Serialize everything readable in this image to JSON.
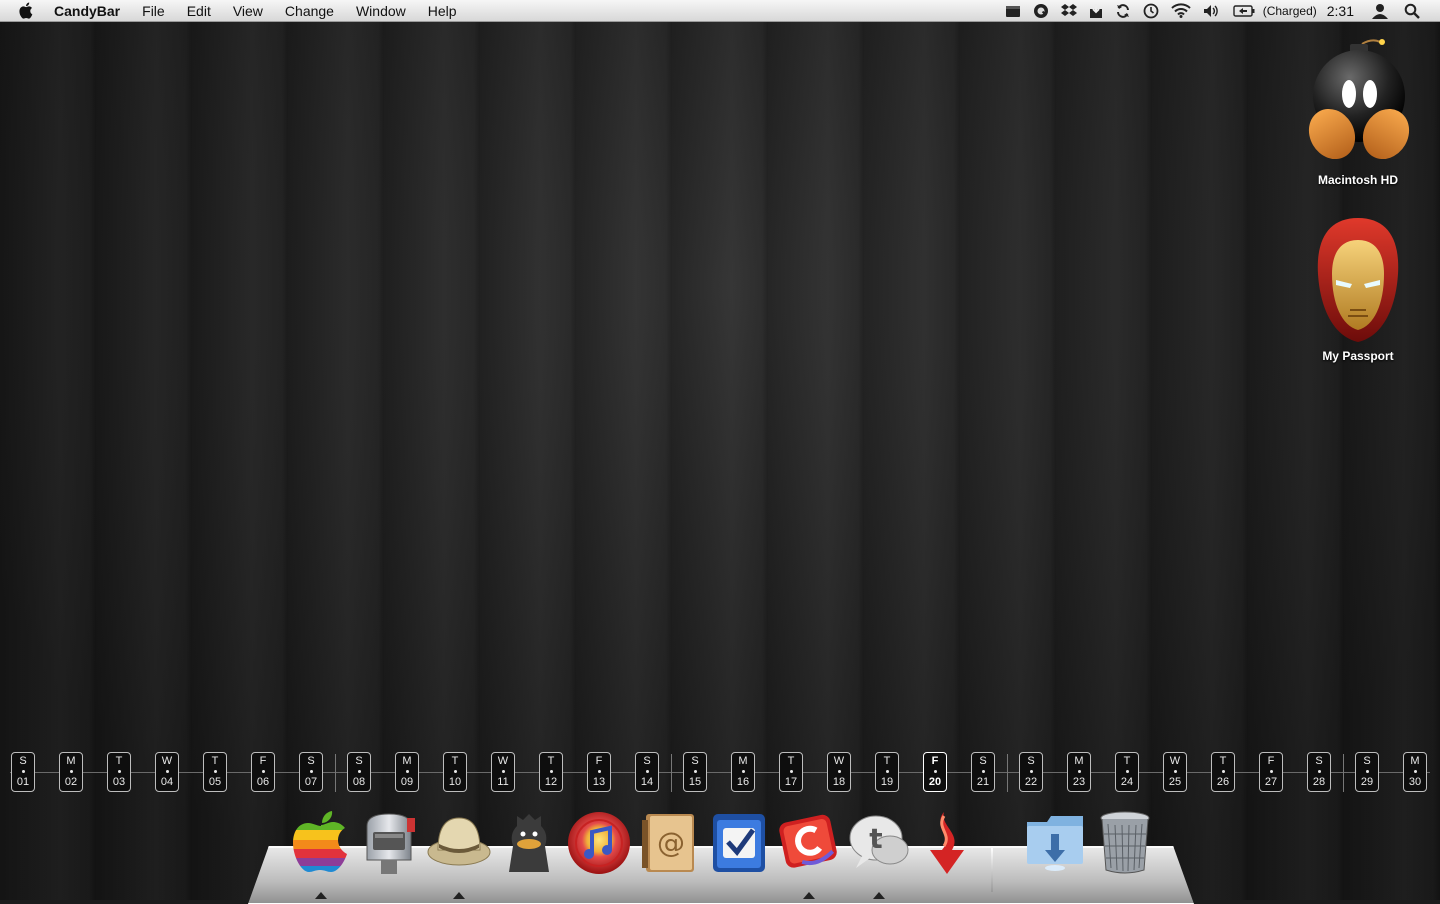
{
  "menubar": {
    "app_name": "CandyBar",
    "menus": [
      "File",
      "Edit",
      "View",
      "Change",
      "Window",
      "Help"
    ],
    "status_icons": [
      "menu-extra-icon",
      "quicksilver-icon",
      "dropbox-icon",
      "download-icon",
      "sync-icon",
      "time-machine-icon",
      "wifi-icon",
      "volume-icon",
      "battery-icon"
    ],
    "battery_status": "(Charged)",
    "clock": "2:31",
    "user_icon": "user-icon",
    "search_icon": "spotlight-icon"
  },
  "desktop_icons": [
    {
      "label": "Macintosh HD",
      "icon": "bomb-disk-icon"
    },
    {
      "label": "My Passport",
      "icon": "iron-man-disk-icon"
    }
  ],
  "calendar": {
    "days": [
      {
        "l": "S",
        "n": "01"
      },
      {
        "l": "M",
        "n": "02"
      },
      {
        "l": "T",
        "n": "03"
      },
      {
        "l": "W",
        "n": "04"
      },
      {
        "l": "T",
        "n": "05"
      },
      {
        "l": "F",
        "n": "06"
      },
      {
        "l": "S",
        "n": "07"
      },
      {
        "l": "S",
        "n": "08"
      },
      {
        "l": "M",
        "n": "09"
      },
      {
        "l": "T",
        "n": "10"
      },
      {
        "l": "W",
        "n": "11"
      },
      {
        "l": "T",
        "n": "12"
      },
      {
        "l": "F",
        "n": "13"
      },
      {
        "l": "S",
        "n": "14"
      },
      {
        "l": "S",
        "n": "15"
      },
      {
        "l": "M",
        "n": "16"
      },
      {
        "l": "T",
        "n": "17"
      },
      {
        "l": "W",
        "n": "18"
      },
      {
        "l": "T",
        "n": "19"
      },
      {
        "l": "F",
        "n": "20"
      },
      {
        "l": "S",
        "n": "21"
      },
      {
        "l": "S",
        "n": "22"
      },
      {
        "l": "M",
        "n": "23"
      },
      {
        "l": "T",
        "n": "24"
      },
      {
        "l": "W",
        "n": "25"
      },
      {
        "l": "T",
        "n": "26"
      },
      {
        "l": "F",
        "n": "27"
      },
      {
        "l": "S",
        "n": "28"
      },
      {
        "l": "S",
        "n": "29"
      },
      {
        "l": "M",
        "n": "30"
      }
    ],
    "today": "20"
  },
  "dock": {
    "apps": [
      {
        "name": "apple-rainbow",
        "icon": "apple-rainbow-icon",
        "running": true
      },
      {
        "name": "mail",
        "icon": "mailbox-icon",
        "running": false
      },
      {
        "name": "safari",
        "icon": "safari-hat-icon",
        "running": true
      },
      {
        "name": "adium",
        "icon": "duck-icon",
        "running": false
      },
      {
        "name": "itunes",
        "icon": "itunes-icon",
        "running": false
      },
      {
        "name": "address-book",
        "icon": "address-book-icon",
        "running": false
      },
      {
        "name": "things",
        "icon": "checkbox-icon",
        "running": false
      },
      {
        "name": "red-app",
        "icon": "red-c-icon",
        "running": true
      },
      {
        "name": "twitter",
        "icon": "twitter-bubble-icon",
        "running": true
      },
      {
        "name": "transmission",
        "icon": "red-arrow-icon",
        "running": false
      }
    ],
    "stacks": [
      {
        "name": "downloads",
        "icon": "downloads-folder-icon"
      },
      {
        "name": "trash",
        "icon": "trash-icon"
      }
    ]
  }
}
